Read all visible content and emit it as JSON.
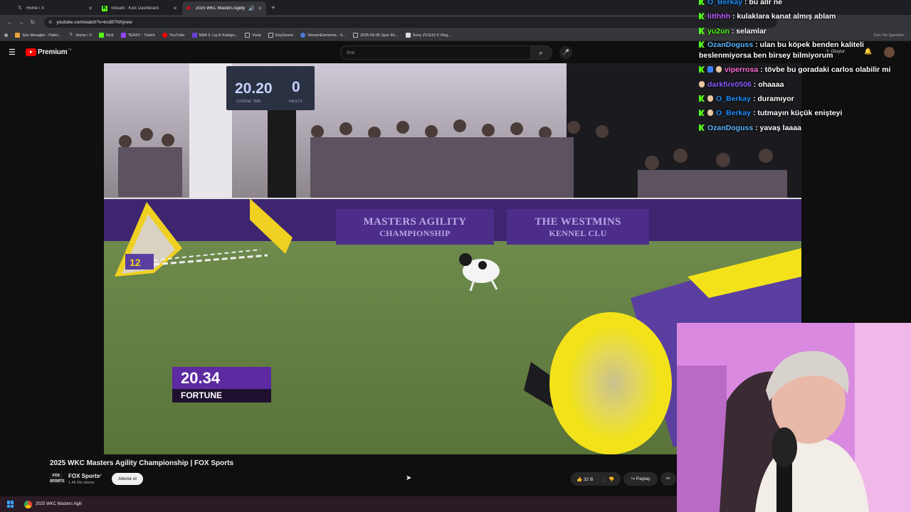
{
  "browser": {
    "tabs": [
      {
        "label": "Home / X",
        "icon": "x-logo-icon",
        "active": false
      },
      {
        "label": "Stream - Kick Dashboard",
        "icon": "kick-logo-icon",
        "active": false
      },
      {
        "label": "2025 WKC Masters Agility C",
        "icon": "youtube-logo-icon",
        "active": true
      }
    ],
    "url": "youtube.com/watch?v=kcd87NXjnew",
    "bookmarks": [
      "Son Mesajlar - Patici...",
      "Home / X",
      "Kick",
      "TEASY - Twitch",
      "YouTube",
      "NBA 3. Lig B Katego...",
      "Voep",
      "KeyGivers",
      "StreamElements - S...",
      "2025-09-06 Spor Ek...",
      "Sony ZV-E10 II Vlog..."
    ],
    "bookmarks_right": "Tüm Yer İşaretleri"
  },
  "youtube": {
    "logo_text": "Premium",
    "logo_tr": "TR",
    "search_placeholder": "Ara",
    "create_label": "Oluştur"
  },
  "video": {
    "scoreboard_time": "20.20",
    "scoreboard_faults": "0",
    "scoreboard_label_time": "COURSE TIME",
    "scoreboard_label_faults": "FAULTS",
    "banner_left_l1": "MASTERS AGILITY",
    "banner_left_l2": "CHAMPIONSHIP",
    "banner_right_l1": "THE WESTMINS",
    "banner_right_l2": "KENNEL CLU",
    "jump_number": "12",
    "lower_third_time": "20.34",
    "lower_third_name": "FORTUNE"
  },
  "video_info": {
    "title": "2025 WKC Masters Agility Championship | FOX Sports",
    "channel_name": "FOX Sports",
    "channel_logo_text": "FOX SPORTS",
    "subscribers": "1,46 Mn abone",
    "subscribe_label": "Abone ol",
    "likes": "32 B",
    "share_label": "Paylaş"
  },
  "taskbar": {
    "app_label": "2025 WKC Masters Agili"
  },
  "chat": [
    {
      "user": "O_Berkay",
      "color": "#1e90ff",
      "text": "bu allr ne",
      "badges": [
        "kick"
      ]
    },
    {
      "user": "litthhh",
      "color": "#b95cff",
      "text": "kulaklara kanat almış ablam",
      "badges": [
        "kick"
      ]
    },
    {
      "user": "yu2un",
      "color": "#53fc18",
      "text": "selamlar",
      "badges": [
        "kick"
      ]
    },
    {
      "user": "OzanDoguss",
      "color": "#5bb6ff",
      "text": "ulan bu köpek benden kaliteli beslenmiyorsa ben birsey bilmiyorum",
      "badges": [
        "kick"
      ]
    },
    {
      "user": "viperrosa",
      "color": "#ff6fd8",
      "text": "tövbe bu goradaki carlos olabilir mi",
      "badges": [
        "kick",
        "blue",
        "face"
      ]
    },
    {
      "user": "darkfire0506",
      "color": "#8a5cff",
      "text": "ohaaaa",
      "badges": [
        "face"
      ]
    },
    {
      "user": "O_Berkay",
      "color": "#1e90ff",
      "text": "duramıyor",
      "badges": [
        "kick",
        "face"
      ]
    },
    {
      "user": "O_Berkay",
      "color": "#1e90ff",
      "text": "tutmayın küçük enişteyi",
      "badges": [
        "kick",
        "face"
      ]
    },
    {
      "user": "OzanDoguss",
      "color": "#5bb6ff",
      "text": "yavaş laaaa",
      "badges": [
        "kick"
      ]
    }
  ]
}
